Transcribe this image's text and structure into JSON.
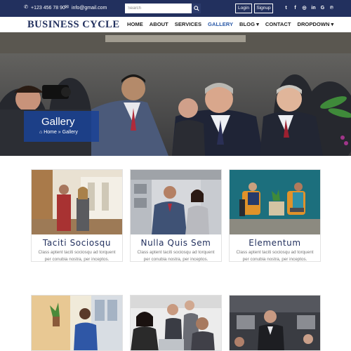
{
  "topbar": {
    "phone": "+123 456 78 90",
    "email": "info@gmail.com",
    "search_placeholder": "Search",
    "login_label": "Login",
    "signup_label": "Signup",
    "social": [
      "twitter",
      "facebook",
      "instagram",
      "linkedin",
      "google",
      "pinterest"
    ]
  },
  "nav": {
    "brand": "BUSINESS CYCLE",
    "items": [
      "HOME",
      "ABOUT",
      "SERVICES",
      "GALLERY",
      "BLOG ▾",
      "CONTACT",
      "DROPDOWN ▾"
    ],
    "active": "GALLERY"
  },
  "hero": {
    "title": "Gallery",
    "breadcrumb": "Home » Gallery"
  },
  "gallery": [
    {
      "title": "Taciti Sociosqu",
      "text": "Class aptent taciti sociosqu ad torquent per conubia nostra, per inceptos."
    },
    {
      "title": "Nulla Quis Sem",
      "text": "Class aptent taciti sociosqu ad torquent per conubia nostra, per inceptos."
    },
    {
      "title": "Elementum",
      "text": "Class aptent taciti sociosqu ad torquent per conubia nostra, per inceptos."
    }
  ],
  "colors": {
    "topbar": "#22305e",
    "brand": "#22305e",
    "active": "#2b5aa8",
    "badge": "#1a4296"
  }
}
